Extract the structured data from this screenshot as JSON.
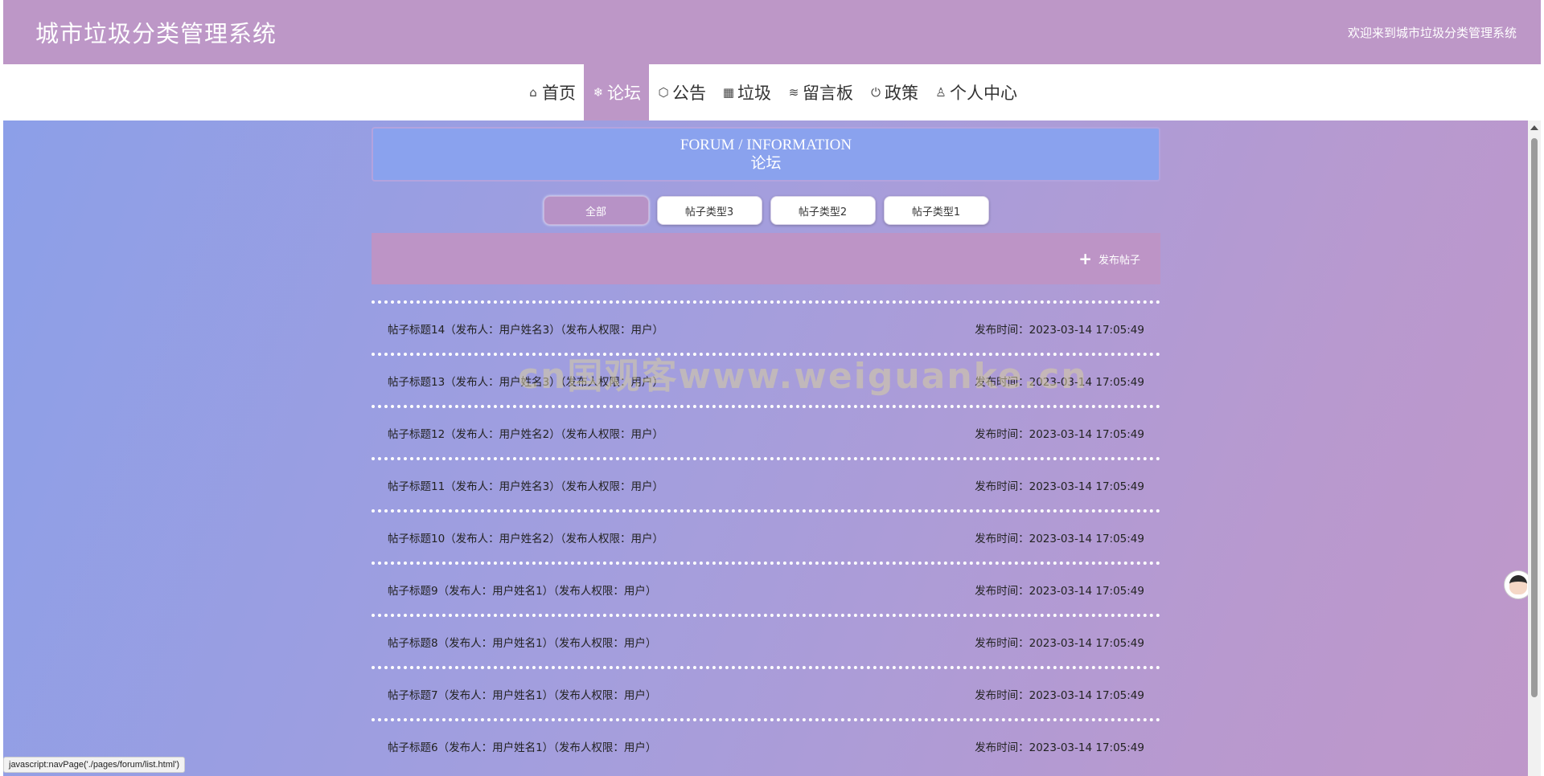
{
  "header": {
    "title": "城市垃圾分类管理系统",
    "welcome": "欢迎来到城市垃圾分类管理系统"
  },
  "nav": {
    "items": [
      {
        "label": "首页",
        "icon": "home-icon",
        "glyph": "⌂",
        "active": false
      },
      {
        "label": "论坛",
        "icon": "snowflake-icon",
        "glyph": "❄",
        "active": true
      },
      {
        "label": "公告",
        "icon": "cube-icon",
        "glyph": "⬡",
        "active": false
      },
      {
        "label": "垃圾",
        "icon": "grid-icon",
        "glyph": "▦",
        "active": false
      },
      {
        "label": "留言板",
        "icon": "layers-icon",
        "glyph": "≋",
        "active": false
      },
      {
        "label": "政策",
        "icon": "power-icon",
        "glyph": "⏻",
        "active": false
      },
      {
        "label": "个人中心",
        "icon": "user-icon",
        "glyph": "♙",
        "active": false
      }
    ]
  },
  "banner": {
    "en": "FORUM / INFORMATION",
    "cn": "论坛"
  },
  "filters": [
    "全部",
    "帖子类型3",
    "帖子类型2",
    "帖子类型1"
  ],
  "publish": {
    "plus": "+",
    "label": "发布帖子"
  },
  "posts": [
    {
      "title": "帖子标题14（发布人：用户姓名3）（发布人权限：用户）",
      "time": "发布时间：2023-03-14 17:05:49"
    },
    {
      "title": "帖子标题13（发布人：用户姓名3）（发布人权限：用户）",
      "time": "发布时间：2023-03-14 17:05:49"
    },
    {
      "title": "帖子标题12（发布人：用户姓名2）（发布人权限：用户）",
      "time": "发布时间：2023-03-14 17:05:49"
    },
    {
      "title": "帖子标题11（发布人：用户姓名3）（发布人权限：用户）",
      "time": "发布时间：2023-03-14 17:05:49"
    },
    {
      "title": "帖子标题10（发布人：用户姓名2）（发布人权限：用户）",
      "time": "发布时间：2023-03-14 17:05:49"
    },
    {
      "title": "帖子标题9（发布人：用户姓名1）（发布人权限：用户）",
      "time": "发布时间：2023-03-14 17:05:49"
    },
    {
      "title": "帖子标题8（发布人：用户姓名1）（发布人权限：用户）",
      "time": "发布时间：2023-03-14 17:05:49"
    },
    {
      "title": "帖子标题7（发布人：用户姓名1）（发布人权限：用户）",
      "time": "发布时间：2023-03-14 17:05:49"
    },
    {
      "title": "帖子标题6（发布人：用户姓名1）（发布人权限：用户）",
      "time": "发布时间：2023-03-14 17:05:49"
    }
  ],
  "watermark": "cn国观客www.weiguanke.cn",
  "status_bar": "javascript:navPage('./pages/forum/list.html')"
}
